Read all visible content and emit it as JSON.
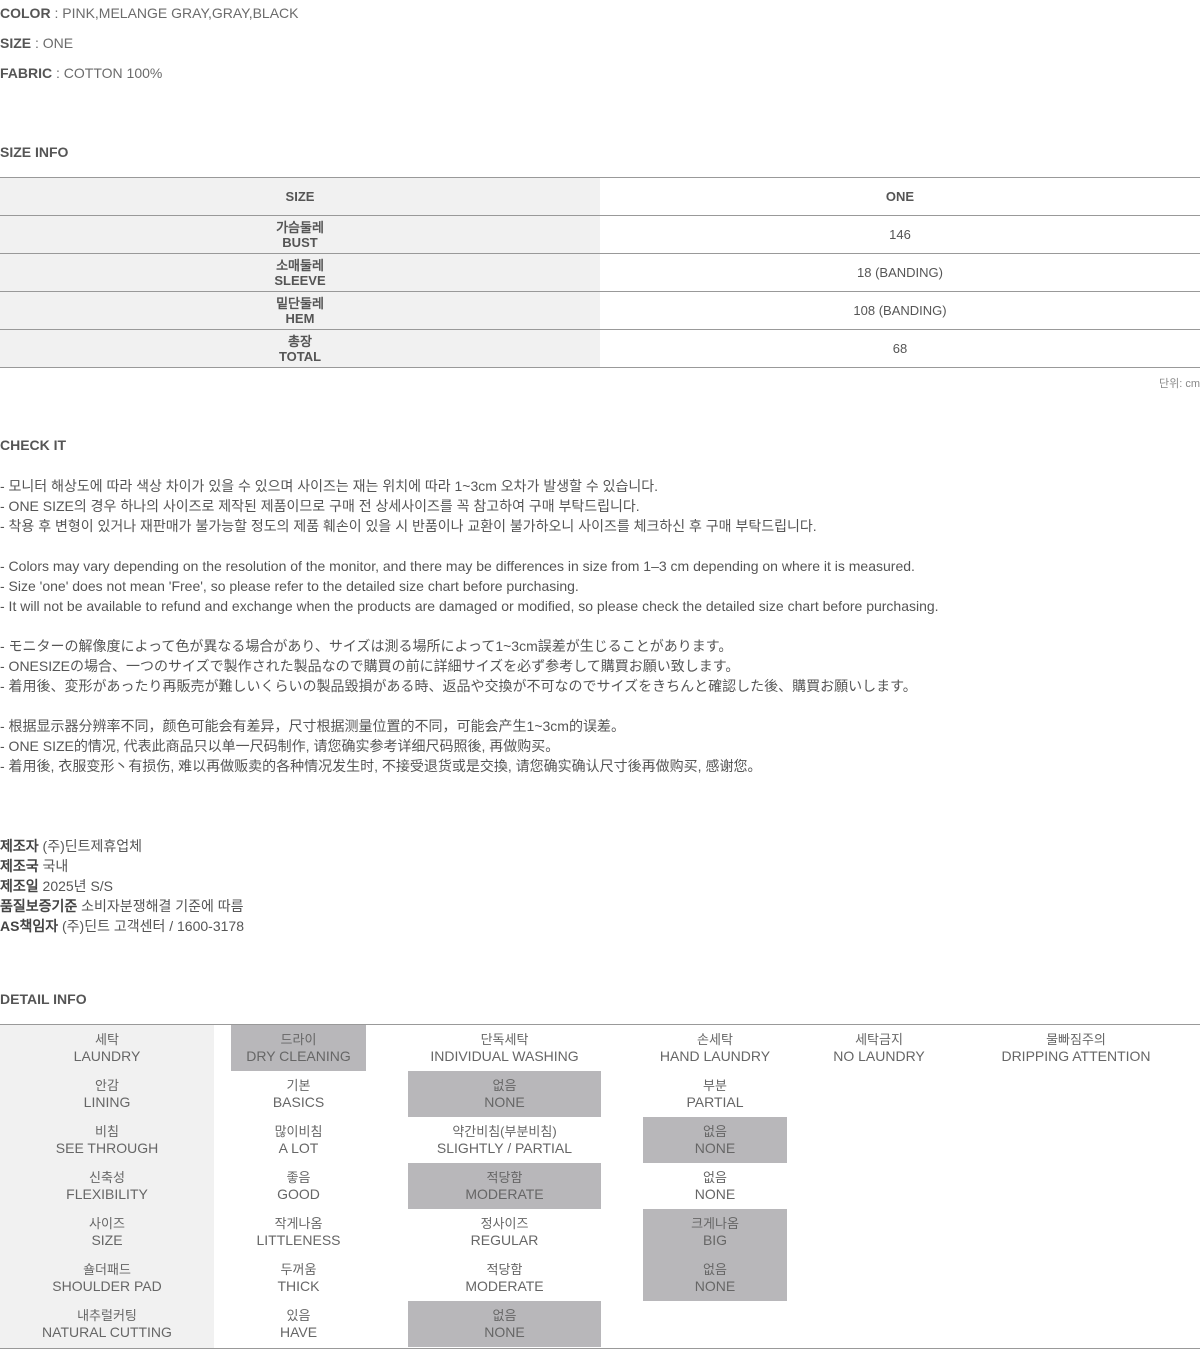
{
  "specs": {
    "color_label": "COLOR",
    "color_value": " : PINK,MELANGE GRAY,GRAY,BLACK",
    "size_label": "SIZE",
    "size_value": " : ONE",
    "fabric_label": "FABRIC",
    "fabric_value": " : COTTON 100%"
  },
  "size_info": {
    "title": "SIZE INFO",
    "header": {
      "label": "SIZE",
      "value": "ONE"
    },
    "rows": [
      {
        "ko": "가슴둘레",
        "en": "BUST",
        "value": "146"
      },
      {
        "ko": "소매둘레",
        "en": "SLEEVE",
        "value": "18 (BANDING)"
      },
      {
        "ko": "밑단둘레",
        "en": "HEM",
        "value": "108 (BANDING)"
      },
      {
        "ko": "총장",
        "en": "TOTAL",
        "value": "68"
      }
    ],
    "unit": "단위: cm"
  },
  "check_it": {
    "title": "CHECK IT",
    "lines": [
      "- 모니터 해상도에 따라 색상 차이가 있을 수 있으며 사이즈는 재는 위치에 따라 1~3cm 오차가 발생할 수 있습니다.",
      "- ONE SIZE의 경우 하나의 사이즈로 제작된 제품이므로 구매 전 상세사이즈를 꼭 참고하여 구매 부탁드립니다.",
      "- 착용 후 변형이 있거나 재판매가 불가능할 정도의 제품 훼손이 있을 시 반품이나 교환이 불가하오니 사이즈를 체크하신 후 구매 부탁드립니다.",
      "",
      "- Colors may vary depending on the resolution of the monitor, and there may be differences in size from 1–3 cm depending on where it is measured.",
      "- Size 'one' does not mean 'Free', so please refer to the detailed size chart before purchasing.",
      "- It will not be available to refund and exchange when the products are damaged or modified, so please check the detailed size chart before purchasing.",
      "",
      "- モニターの解像度によって色が異なる場合があり、サイズは測る場所によって1~3cm誤差が生じることがあります。",
      "- ONESIZEの場合、一つのサイズで製作された製品なので購買の前に詳細サイズを必ず参考して購買お願い致します。",
      "- 着用後、変形があったり再販売が難しいくらいの製品毀損がある時、返品や交換が不可なのでサイズをきちんと確認した後、購買お願いします。",
      "",
      "- 根据显示器分辨率不同，颜色可能会有差异，尺寸根据测量位置的不同，可能会产生1~3cm的误差。",
      "- ONE SIZE的情况, 代表此商品只以单一尺码制作, 请您确实参考详细尺码照後, 再做购买。",
      "- 着用後, 衣服变形丶有损伤, 难以再做贩卖的各种情况发生时, 不接受退货或是交換, 请您确实确认尺寸後再做购买, 感谢您。"
    ]
  },
  "manufacturer": [
    {
      "label": "제조자",
      "value": " (주)딘트제휴업체"
    },
    {
      "label": "제조국",
      "value": " 국내"
    },
    {
      "label": "제조일",
      "value": " 2025년 S/S"
    },
    {
      "label": "품질보증기준",
      "value": " 소비자분쟁해결 기준에 따름"
    },
    {
      "label": "AS책임자",
      "value": " (주)딘트 고객센터 / 1600-3178"
    }
  ],
  "detail_info": {
    "title": "DETAIL INFO",
    "rows": [
      {
        "label": {
          "ko": "세탁",
          "en": "LAUNDRY"
        },
        "options": [
          {
            "ko": "드라이",
            "en": "DRY CLEANING",
            "selected": true
          },
          {
            "ko": "단독세탁",
            "en": "INDIVIDUAL WASHING",
            "selected": false
          },
          {
            "ko": "손세탁",
            "en": "HAND LAUNDRY",
            "selected": false
          },
          {
            "ko": "세탁금지",
            "en": "NO LAUNDRY",
            "selected": false
          },
          {
            "ko": "물빠짐주의",
            "en": "DRIPPING ATTENTION",
            "selected": false
          }
        ]
      },
      {
        "label": {
          "ko": "안감",
          "en": "LINING"
        },
        "options": [
          {
            "ko": "기본",
            "en": "BASICS",
            "selected": false
          },
          {
            "ko": "없음",
            "en": "NONE",
            "selected": true
          },
          {
            "ko": "부분",
            "en": "PARTIAL",
            "selected": false
          }
        ]
      },
      {
        "label": {
          "ko": "비침",
          "en": "SEE THROUGH"
        },
        "options": [
          {
            "ko": "많이비침",
            "en": "A LOT",
            "selected": false
          },
          {
            "ko": "약간비침(부분비침)",
            "en": "SLIGHTLY / PARTIAL",
            "selected": false
          },
          {
            "ko": "없음",
            "en": "NONE",
            "selected": true
          }
        ]
      },
      {
        "label": {
          "ko": "신축성",
          "en": "FLEXIBILITY"
        },
        "options": [
          {
            "ko": "좋음",
            "en": "GOOD",
            "selected": false
          },
          {
            "ko": "적당함",
            "en": "MODERATE",
            "selected": true
          },
          {
            "ko": "없음",
            "en": "NONE",
            "selected": false
          }
        ]
      },
      {
        "label": {
          "ko": "사이즈",
          "en": "SIZE"
        },
        "options": [
          {
            "ko": "작게나옴",
            "en": "LITTLENESS",
            "selected": false
          },
          {
            "ko": "정사이즈",
            "en": "REGULAR",
            "selected": false
          },
          {
            "ko": "크게나옴",
            "en": "BIG",
            "selected": true
          }
        ]
      },
      {
        "label": {
          "ko": "숄더패드",
          "en": "SHOULDER PAD"
        },
        "options": [
          {
            "ko": "두꺼움",
            "en": "THICK",
            "selected": false
          },
          {
            "ko": "적당함",
            "en": "MODERATE",
            "selected": false
          },
          {
            "ko": "없음",
            "en": "NONE",
            "selected": true
          }
        ]
      },
      {
        "label": {
          "ko": "내추럴커팅",
          "en": "NATURAL CUTTING"
        },
        "options": [
          {
            "ko": "있음",
            "en": "HAVE",
            "selected": false
          },
          {
            "ko": "없음",
            "en": "NONE",
            "selected": true
          }
        ]
      }
    ]
  }
}
